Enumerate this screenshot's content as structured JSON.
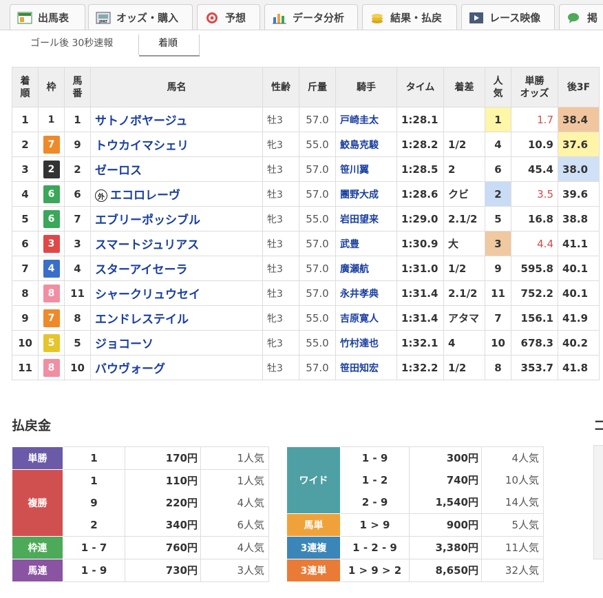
{
  "nav": {
    "tabs": [
      {
        "label": "出馬表",
        "icon": "entry-table-icon"
      },
      {
        "label": "オッズ・購入",
        "icon": "odds-jpat-icon"
      },
      {
        "label": "予想",
        "icon": "target-icon"
      },
      {
        "label": "データ分析",
        "icon": "bar-chart-icon"
      },
      {
        "label": "結果・払戻",
        "icon": "coins-icon"
      },
      {
        "label": "レース映像",
        "icon": "video-icon"
      },
      {
        "label": "掲",
        "icon": "chat-icon"
      }
    ]
  },
  "subtabs": [
    {
      "label": "ゴール後 30秒速報",
      "active": false
    },
    {
      "label": "着順",
      "active": true
    }
  ],
  "results": {
    "headers": {
      "rank": "着\n順",
      "waku": "枠",
      "umaban": "馬\n番",
      "name": "馬名",
      "sex_age": "性齢",
      "weight": "斤量",
      "jockey": "騎手",
      "time": "タイム",
      "margin": "着差",
      "popularity": "人\n気",
      "odds": "単勝\nオッズ",
      "last3f": "後3F"
    },
    "rows": [
      {
        "rank": "1",
        "waku": "1",
        "umaban": "1",
        "name": "サトノボヤージュ",
        "gai": false,
        "sex_age": "牡3",
        "weight": "57.0",
        "jockey": "戸崎圭太",
        "time": "1:28.1",
        "margin": "",
        "popularity": "1",
        "odds": "1.7",
        "last3f": "38.4"
      },
      {
        "rank": "2",
        "waku": "7",
        "umaban": "9",
        "name": "トウカイマシェリ",
        "gai": false,
        "sex_age": "牝3",
        "weight": "55.0",
        "jockey": "鮫島克駿",
        "time": "1:28.2",
        "margin": "1/2",
        "popularity": "4",
        "odds": "10.9",
        "last3f": "37.6"
      },
      {
        "rank": "3",
        "waku": "2",
        "umaban": "2",
        "name": "ゼーロス",
        "gai": false,
        "sex_age": "牡3",
        "weight": "57.0",
        "jockey": "笹川翼",
        "time": "1:28.5",
        "margin": "2",
        "popularity": "6",
        "odds": "45.4",
        "last3f": "38.0"
      },
      {
        "rank": "4",
        "waku": "6",
        "umaban": "6",
        "name": "エコロレーヴ",
        "gai": true,
        "gai_label": "外",
        "sex_age": "牡3",
        "weight": "57.0",
        "jockey": "團野大成",
        "time": "1:28.6",
        "margin": "クビ",
        "popularity": "2",
        "odds": "3.5",
        "last3f": "39.6"
      },
      {
        "rank": "5",
        "waku": "6",
        "umaban": "7",
        "name": "エブリーポッシブル",
        "gai": false,
        "sex_age": "牝3",
        "weight": "55.0",
        "jockey": "岩田望来",
        "time": "1:29.0",
        "margin": "2.1/2",
        "popularity": "5",
        "odds": "16.8",
        "last3f": "38.8"
      },
      {
        "rank": "6",
        "waku": "3",
        "umaban": "3",
        "name": "スマートジュリアス",
        "gai": false,
        "sex_age": "牡3",
        "weight": "57.0",
        "jockey": "武豊",
        "time": "1:30.9",
        "margin": "大",
        "popularity": "3",
        "odds": "4.4",
        "last3f": "41.1"
      },
      {
        "rank": "7",
        "waku": "4",
        "umaban": "4",
        "name": "スターアイセーラ",
        "gai": false,
        "sex_age": "牡3",
        "weight": "57.0",
        "jockey": "廣瀬航",
        "time": "1:31.0",
        "margin": "1/2",
        "popularity": "9",
        "odds": "595.8",
        "last3f": "40.1"
      },
      {
        "rank": "8",
        "waku": "8",
        "umaban": "11",
        "name": "シャークリュウセイ",
        "gai": false,
        "sex_age": "牡3",
        "weight": "57.0",
        "jockey": "永井孝典",
        "time": "1:31.4",
        "margin": "2.1/2",
        "popularity": "11",
        "odds": "752.2",
        "last3f": "40.1"
      },
      {
        "rank": "9",
        "waku": "7",
        "umaban": "8",
        "name": "エンドレステイル",
        "gai": false,
        "sex_age": "牝3",
        "weight": "55.0",
        "jockey": "吉原寛人",
        "time": "1:31.4",
        "margin": "アタマ",
        "popularity": "7",
        "odds": "156.1",
        "last3f": "41.9"
      },
      {
        "rank": "10",
        "waku": "5",
        "umaban": "5",
        "name": "ジョコーソ",
        "gai": false,
        "sex_age": "牝3",
        "weight": "55.0",
        "jockey": "竹村達也",
        "time": "1:32.1",
        "margin": "4",
        "popularity": "10",
        "odds": "678.3",
        "last3f": "40.2"
      },
      {
        "rank": "11",
        "waku": "8",
        "umaban": "10",
        "name": "バウヴォーグ",
        "gai": false,
        "sex_age": "牡3",
        "weight": "57.0",
        "jockey": "笹田知宏",
        "time": "1:32.2",
        "margin": "1/2",
        "popularity": "8",
        "odds": "353.7",
        "last3f": "41.8"
      }
    ]
  },
  "colors": {
    "waku": {
      "1": "#ffffff",
      "2": "#333333",
      "3": "#e04848",
      "4": "#3a6fc9",
      "5": "#e6c52c",
      "6": "#3aa75a",
      "7": "#ef8a2a",
      "8": "#f08fa3"
    },
    "pop1": "#fff6a8",
    "pop2": "#c9dcf6",
    "pop3": "#f0c9a0",
    "f3_best": "#f1c59d",
    "f3_second": "#fff4a8",
    "f3_third": "#cfe0f7"
  },
  "payout": {
    "title": "払戻金",
    "title_right": "コ",
    "left": [
      {
        "label": "単勝",
        "color": "#6b5aa8",
        "entries": [
          {
            "num": "1",
            "yen": "170円",
            "pop": "1人気"
          }
        ]
      },
      {
        "label": "複勝",
        "color": "#d05050",
        "entries": [
          {
            "num": "1",
            "yen": "110円",
            "pop": "1人気"
          },
          {
            "num": "9",
            "yen": "220円",
            "pop": "4人気"
          },
          {
            "num": "2",
            "yen": "340円",
            "pop": "6人気"
          }
        ]
      },
      {
        "label": "枠連",
        "color": "#4caa58",
        "entries": [
          {
            "num": "1 - 7",
            "yen": "760円",
            "pop": "4人気"
          }
        ]
      },
      {
        "label": "馬連",
        "color": "#8b54a3",
        "entries": [
          {
            "num": "1 - 9",
            "yen": "730円",
            "pop": "3人気"
          }
        ]
      }
    ],
    "right": [
      {
        "label": "ワイド",
        "color": "#4ea0a4",
        "entries": [
          {
            "num": "1 - 9",
            "yen": "300円",
            "pop": "4人気"
          },
          {
            "num": "1 - 2",
            "yen": "740円",
            "pop": "10人気"
          },
          {
            "num": "2 - 9",
            "yen": "1,540円",
            "pop": "14人気"
          }
        ]
      },
      {
        "label": "馬単",
        "color": "#f0a23a",
        "entries": [
          {
            "num": "1 > 9",
            "yen": "900円",
            "pop": "5人気"
          }
        ]
      },
      {
        "label": "3連複",
        "color": "#3b86b8",
        "entries": [
          {
            "num": "1 - 2 - 9",
            "yen": "3,380円",
            "pop": "11人気"
          }
        ]
      },
      {
        "label": "3連単",
        "color": "#ea7b36",
        "entries": [
          {
            "num": "1 > 9 > 2",
            "yen": "8,650円",
            "pop": "32人気"
          }
        ]
      }
    ]
  }
}
